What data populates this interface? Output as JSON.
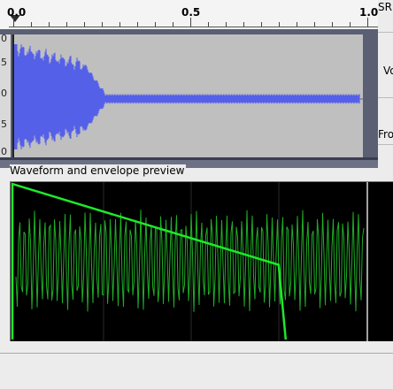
{
  "ruler": {
    "tick_labels": [
      "0.0",
      "0.5",
      "1.0"
    ]
  },
  "track": {
    "scale_labels": [
      "0",
      "5",
      "0",
      "5",
      "0"
    ],
    "wave_color": "#5560e8"
  },
  "side_panel": {
    "top_label": "SR",
    "mid_label": "Vo",
    "bottom_label": "Fro"
  },
  "preview": {
    "title": "Waveform and envelope preview",
    "wave_color": "#22c02a",
    "envelope_color": "#1fe82a",
    "envelope": {
      "type": "line",
      "points": [
        [
          0.0,
          1.0
        ],
        [
          0.0,
          0.0
        ],
        [
          0.0,
          1.0
        ],
        [
          0.75,
          0.48
        ],
        [
          0.77,
          0.0
        ]
      ]
    }
  }
}
